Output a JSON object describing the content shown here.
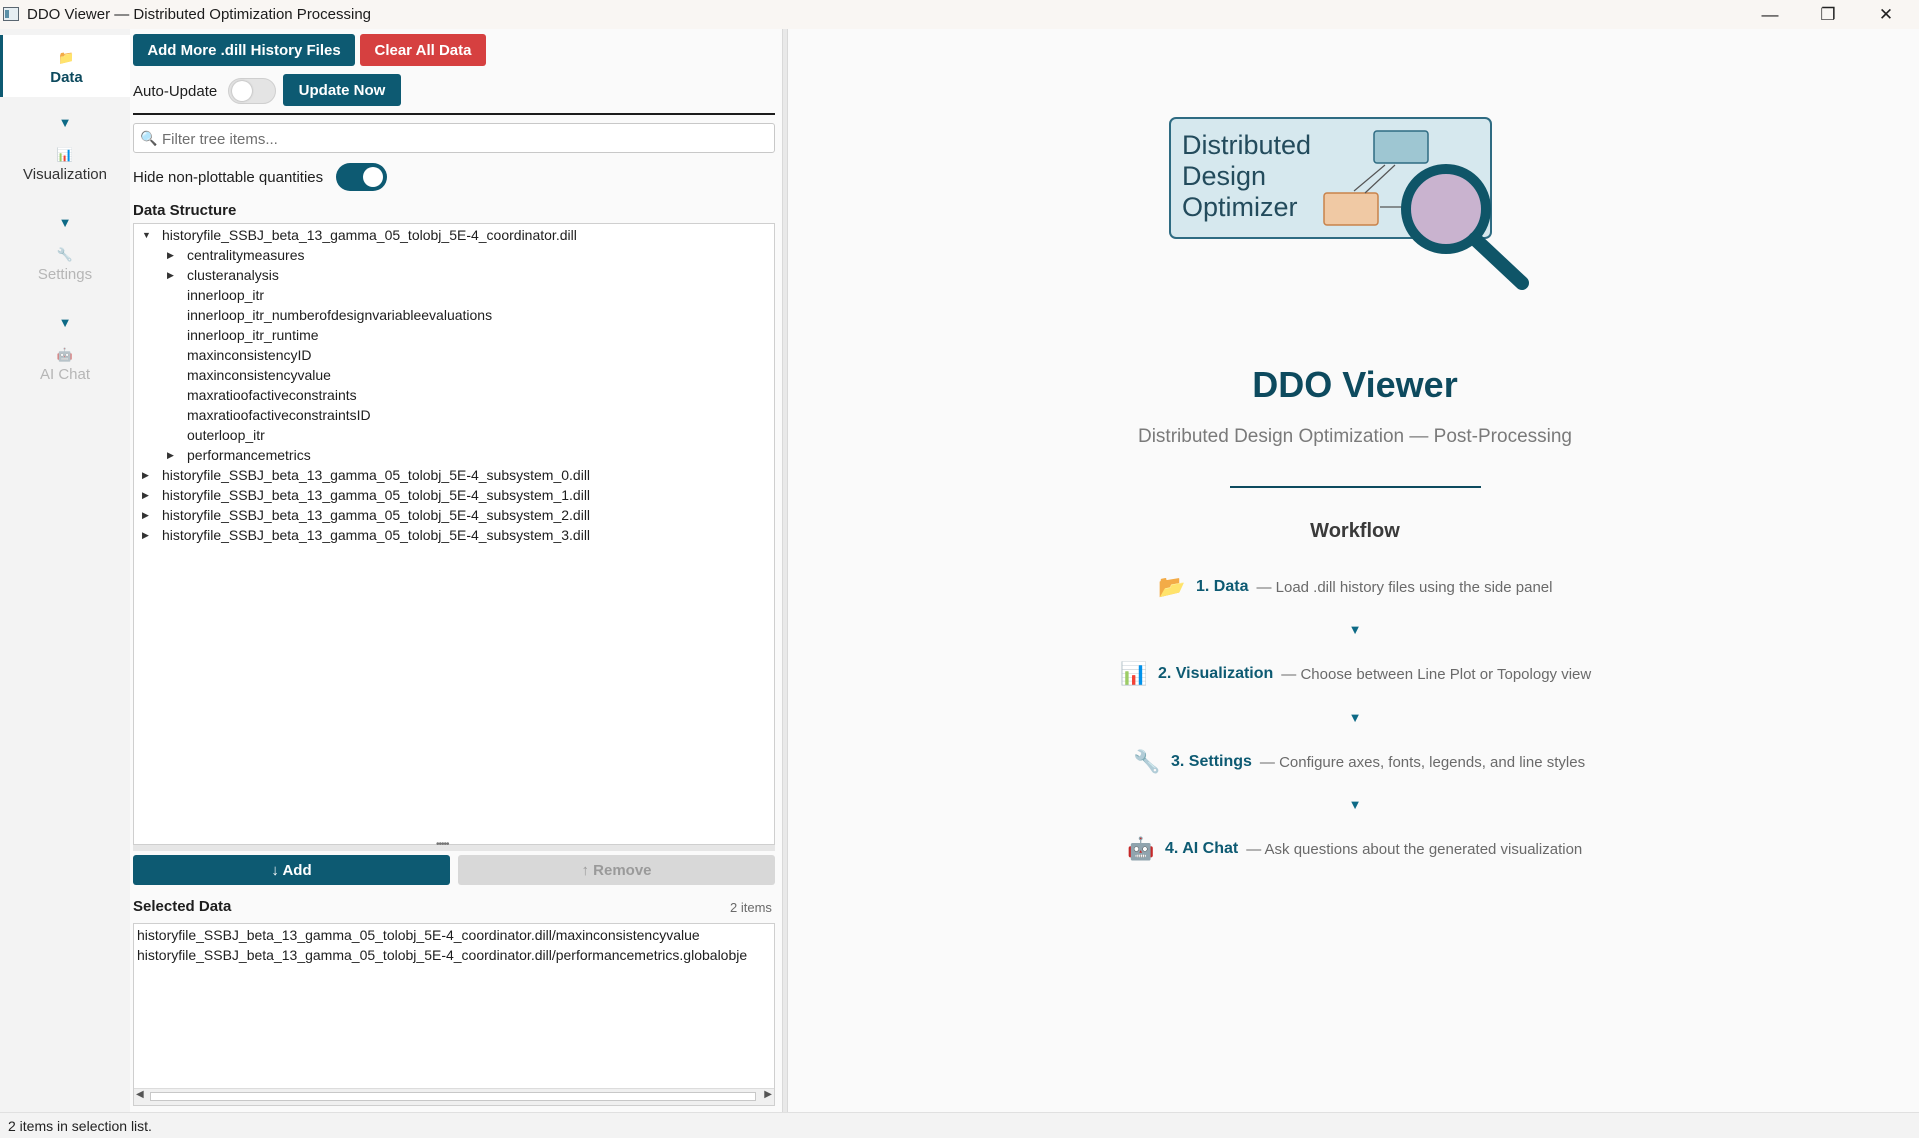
{
  "window": {
    "title": "DDO Viewer — Distributed Optimization Processing",
    "minimize_glyph": "—",
    "maximize_glyph": "❐",
    "close_glyph": "✕"
  },
  "nav": {
    "items": [
      {
        "label": "Data",
        "icon": "folder-icon",
        "glyph": "📁",
        "active": true
      },
      {
        "label": "Visualization",
        "icon": "bar-chart-icon",
        "glyph": "📊",
        "active": false
      },
      {
        "label": "Settings",
        "icon": "wrench-icon",
        "glyph": "🔧",
        "active": false,
        "disabled": true
      },
      {
        "label": "AI Chat",
        "icon": "robot-icon",
        "glyph": "🤖",
        "active": false,
        "disabled": true
      }
    ],
    "arrow_glyph": "▼"
  },
  "toolbar": {
    "add_files_label": "Add More .dill History Files",
    "clear_label": "Clear All Data",
    "auto_update_label": "Auto-Update",
    "auto_update_on": false,
    "update_now_label": "Update Now"
  },
  "filter": {
    "placeholder": "Filter tree items...",
    "value": "",
    "icon_glyph": "🔍"
  },
  "hide_nonplottable": {
    "label": "Hide non-plottable quantities",
    "on": true
  },
  "data_structure": {
    "title": "Data Structure",
    "tree": [
      {
        "label": "historyfile_SSBJ_beta_13_gamma_05_tolobj_5E-4_coordinator.dill",
        "depth": 0,
        "expander": "▼"
      },
      {
        "label": "centralitymeasures",
        "depth": 1,
        "expander": "▶"
      },
      {
        "label": "clusteranalysis",
        "depth": 1,
        "expander": "▶"
      },
      {
        "label": "innerloop_itr",
        "depth": 1,
        "expander": ""
      },
      {
        "label": "innerloop_itr_numberofdesignvariableevaluations",
        "depth": 1,
        "expander": ""
      },
      {
        "label": "innerloop_itr_runtime",
        "depth": 1,
        "expander": ""
      },
      {
        "label": "maxinconsistencyID",
        "depth": 1,
        "expander": ""
      },
      {
        "label": "maxinconsistencyvalue",
        "depth": 1,
        "expander": ""
      },
      {
        "label": "maxratioofactiveconstraints",
        "depth": 1,
        "expander": ""
      },
      {
        "label": "maxratioofactiveconstraintsID",
        "depth": 1,
        "expander": ""
      },
      {
        "label": "outerloop_itr",
        "depth": 1,
        "expander": ""
      },
      {
        "label": "performancemetrics",
        "depth": 1,
        "expander": "▶"
      },
      {
        "label": "historyfile_SSBJ_beta_13_gamma_05_tolobj_5E-4_subsystem_0.dill",
        "depth": 0,
        "expander": "▶"
      },
      {
        "label": "historyfile_SSBJ_beta_13_gamma_05_tolobj_5E-4_subsystem_1.dill",
        "depth": 0,
        "expander": "▶"
      },
      {
        "label": "historyfile_SSBJ_beta_13_gamma_05_tolobj_5E-4_subsystem_2.dill",
        "depth": 0,
        "expander": "▶"
      },
      {
        "label": "historyfile_SSBJ_beta_13_gamma_05_tolobj_5E-4_subsystem_3.dill",
        "depth": 0,
        "expander": "▶"
      }
    ],
    "splitter_glyph": "•••••"
  },
  "actions": {
    "add_label": "↓ Add",
    "remove_label": "↑ Remove"
  },
  "selected": {
    "title": "Selected Data",
    "count_label": "2 items",
    "items": [
      "historyfile_SSBJ_beta_13_gamma_05_tolobj_5E-4_coordinator.dill/maxinconsistencyvalue",
      "historyfile_SSBJ_beta_13_gamma_05_tolobj_5E-4_coordinator.dill/performancemetrics.globalobje"
    ],
    "scroll_left_glyph": "◀",
    "scroll_right_glyph": "▶"
  },
  "logo": {
    "lines": [
      "Distributed",
      "Design",
      "Optimizer"
    ]
  },
  "welcome": {
    "title": "DDO Viewer",
    "subtitle": "Distributed Design Optimization — Post-Processing",
    "workflow_title": "Workflow",
    "steps": [
      {
        "name": "1. Data",
        "desc": "— Load .dill history files using the side panel",
        "icon": "folder-icon",
        "glyph": "📂"
      },
      {
        "name": "2. Visualization",
        "desc": "— Choose between Line Plot or Topology view",
        "icon": "bar-chart-icon",
        "glyph": "📊"
      },
      {
        "name": "3. Settings",
        "desc": "— Configure axes, fonts, legends, and line styles",
        "icon": "wrench-icon",
        "glyph": "🔧"
      },
      {
        "name": "4. AI Chat",
        "desc": "— Ask questions about the generated visualization",
        "icon": "robot-icon",
        "glyph": "🤖"
      }
    ],
    "arrow_glyph": "▼"
  },
  "status": {
    "text": "2 items in selection list."
  },
  "colors": {
    "primary": "#0d5a72",
    "danger": "#d64040",
    "muted_text": "#7a7a7a"
  }
}
